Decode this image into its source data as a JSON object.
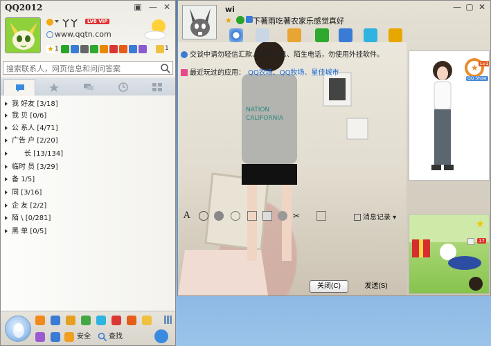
{
  "main": {
    "app_title": "QQ2012",
    "nickname": "丫丫",
    "vip_label": "LV8 VIP",
    "website": "www.qqtn.com",
    "mail_count": "1",
    "search_placeholder": "搜索联系人，网页信息和问问答案",
    "groups": [
      {
        "name": "我 好友",
        "count": "[3/18]"
      },
      {
        "name": "我 贝",
        "count": "[0/6]"
      },
      {
        "name": "公 系人",
        "count": "[4/71]"
      },
      {
        "name": "广告 户",
        "count": "[2/20]"
      },
      {
        "name": "长",
        "count": "[13/134]"
      },
      {
        "name": "临时 员",
        "count": "[3/29]"
      },
      {
        "name": "备",
        "count": "1/5]"
      },
      {
        "name": "同",
        "count": "[3/16]"
      },
      {
        "name": "企 友",
        "count": "[2/2]"
      },
      {
        "name": "陌 \\",
        "count": "[0/281]"
      },
      {
        "name": "黑 单",
        "count": "[0/5]"
      }
    ],
    "bottom_security": "安全",
    "bottom_search": "查找"
  },
  "chat": {
    "contact_name": "wi",
    "signature": "下著雨吃著农家乐感觉真好",
    "warning": "交谈中请勿轻信汇款、中奖信息、陌生电话，勿使用外挂软件。",
    "recent_apps_label": "最近玩过的应用：",
    "recent_apps": [
      "QQ农场、",
      "QQ牧场、",
      "星佳城市"
    ],
    "history_label": "消息记录",
    "close_label": "关闭(C)",
    "send_label": "发送(S)",
    "show_label": "QQ Show",
    "show_level": "Lv1",
    "show_count": "17"
  },
  "colors": {
    "accent_blue": "#1b6ad8",
    "vip_red": "#e03030",
    "avatar_green": "#8fd13c"
  }
}
